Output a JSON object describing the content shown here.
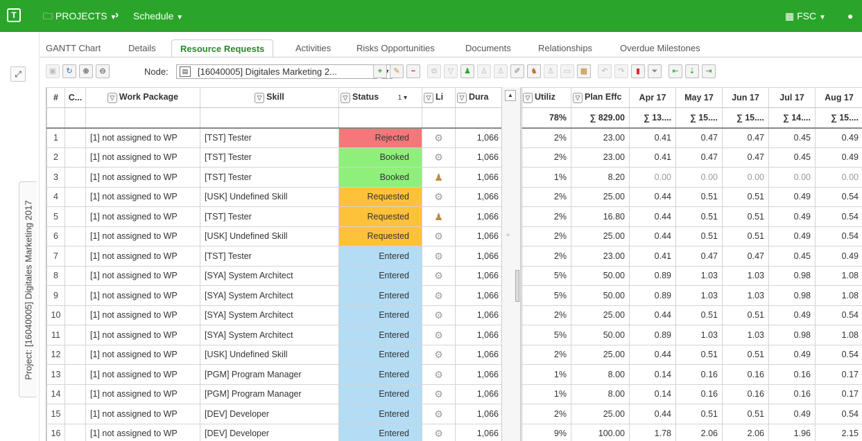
{
  "topbar": {
    "projects_label": "PROJECTS",
    "schedule_label": "Schedule",
    "user_label": "FSC"
  },
  "side": {
    "vertical_tab_label": "Project: [16040005] Digitales Marketing 2017"
  },
  "tabs": [
    {
      "label": "GANTT Chart"
    },
    {
      "label": "Details"
    },
    {
      "label": "Resource Requests"
    },
    {
      "label": "Activities"
    },
    {
      "label": "Risks Opportunities"
    },
    {
      "label": "Documents"
    },
    {
      "label": "Relationships"
    },
    {
      "label": "Overdue Milestones"
    }
  ],
  "toolbar": {
    "node_label": "Node:",
    "node_value": "[16040005] Digitales Marketing 2..."
  },
  "left_headers": {
    "num": "#",
    "c": "C...",
    "work_package": "Work Package",
    "skill": "Skill",
    "status": "Status",
    "sort": "1 ▾",
    "li": "Li",
    "dura": "Dura"
  },
  "right_headers": {
    "utiliz": "Utiliz",
    "plan_effort": "Plan Effc",
    "months": [
      "Apr 17",
      "May 17",
      "Jun 17",
      "Jul 17",
      "Aug 17"
    ]
  },
  "summary": {
    "utiliz": "78%",
    "plan_effort": "∑ 829.00",
    "months": [
      "∑ 13....",
      "∑ 15....",
      "∑ 15....",
      "∑ 14....",
      "∑ 15...."
    ]
  },
  "rows": [
    {
      "n": "1",
      "wp": "[1] not assigned to WP",
      "skill": "[TST] Tester",
      "status": "Rejected",
      "icon": "gear",
      "dur": "1,066",
      "util": "2%",
      "plan": "23.00",
      "m": [
        "0.41",
        "0.47",
        "0.47",
        "0.45",
        "0.49"
      ]
    },
    {
      "n": "2",
      "wp": "[1] not assigned to WP",
      "skill": "[TST] Tester",
      "status": "Booked",
      "icon": "gear",
      "dur": "1,066",
      "util": "2%",
      "plan": "23.00",
      "m": [
        "0.41",
        "0.47",
        "0.47",
        "0.45",
        "0.49"
      ]
    },
    {
      "n": "3",
      "wp": "[1] not assigned to WP",
      "skill": "[TST] Tester",
      "status": "Booked",
      "icon": "person",
      "dur": "1,066",
      "util": "1%",
      "plan": "8.20",
      "m": [
        "0.00",
        "0.00",
        "0.00",
        "0.00",
        "0.00"
      ]
    },
    {
      "n": "4",
      "wp": "[1] not assigned to WP",
      "skill": "[USK] Undefined Skill",
      "status": "Requested",
      "icon": "gear",
      "dur": "1,066",
      "util": "2%",
      "plan": "25.00",
      "m": [
        "0.44",
        "0.51",
        "0.51",
        "0.49",
        "0.54"
      ]
    },
    {
      "n": "5",
      "wp": "[1] not assigned to WP",
      "skill": "[TST] Tester",
      "status": "Requested",
      "icon": "person",
      "dur": "1,066",
      "util": "2%",
      "plan": "16.80",
      "m": [
        "0.44",
        "0.51",
        "0.51",
        "0.49",
        "0.54"
      ]
    },
    {
      "n": "6",
      "wp": "[1] not assigned to WP",
      "skill": "[USK] Undefined Skill",
      "status": "Requested",
      "icon": "gear",
      "dur": "1,066",
      "util": "2%",
      "plan": "25.00",
      "m": [
        "0.44",
        "0.51",
        "0.51",
        "0.49",
        "0.54"
      ]
    },
    {
      "n": "7",
      "wp": "[1] not assigned to WP",
      "skill": "[TST] Tester",
      "status": "Entered",
      "icon": "gear",
      "dur": "1,066",
      "util": "2%",
      "plan": "23.00",
      "m": [
        "0.41",
        "0.47",
        "0.47",
        "0.45",
        "0.49"
      ]
    },
    {
      "n": "8",
      "wp": "[1] not assigned to WP",
      "skill": "[SYA] System Architect",
      "status": "Entered",
      "icon": "gear",
      "dur": "1,066",
      "util": "5%",
      "plan": "50.00",
      "m": [
        "0.89",
        "1.03",
        "1.03",
        "0.98",
        "1.08"
      ]
    },
    {
      "n": "9",
      "wp": "[1] not assigned to WP",
      "skill": "[SYA] System Architect",
      "status": "Entered",
      "icon": "gear",
      "dur": "1,066",
      "util": "5%",
      "plan": "50.00",
      "m": [
        "0.89",
        "1.03",
        "1.03",
        "0.98",
        "1.08"
      ]
    },
    {
      "n": "10",
      "wp": "[1] not assigned to WP",
      "skill": "[SYA] System Architect",
      "status": "Entered",
      "icon": "gear",
      "dur": "1,066",
      "util": "2%",
      "plan": "25.00",
      "m": [
        "0.44",
        "0.51",
        "0.51",
        "0.49",
        "0.54"
      ]
    },
    {
      "n": "11",
      "wp": "[1] not assigned to WP",
      "skill": "[SYA] System Architect",
      "status": "Entered",
      "icon": "gear",
      "dur": "1,066",
      "util": "5%",
      "plan": "50.00",
      "m": [
        "0.89",
        "1.03",
        "1.03",
        "0.98",
        "1.08"
      ]
    },
    {
      "n": "12",
      "wp": "[1] not assigned to WP",
      "skill": "[USK] Undefined Skill",
      "status": "Entered",
      "icon": "gear",
      "dur": "1,066",
      "util": "2%",
      "plan": "25.00",
      "m": [
        "0.44",
        "0.51",
        "0.51",
        "0.49",
        "0.54"
      ]
    },
    {
      "n": "13",
      "wp": "[1] not assigned to WP",
      "skill": "[PGM] Program Manager",
      "status": "Entered",
      "icon": "gear",
      "dur": "1,066",
      "util": "1%",
      "plan": "8.00",
      "m": [
        "0.14",
        "0.16",
        "0.16",
        "0.16",
        "0.17"
      ]
    },
    {
      "n": "14",
      "wp": "[1] not assigned to WP",
      "skill": "[PGM] Program Manager",
      "status": "Entered",
      "icon": "gear",
      "dur": "1,066",
      "util": "1%",
      "plan": "8.00",
      "m": [
        "0.14",
        "0.16",
        "0.16",
        "0.16",
        "0.17"
      ]
    },
    {
      "n": "15",
      "wp": "[1] not assigned to WP",
      "skill": "[DEV] Developer",
      "status": "Entered",
      "icon": "gear",
      "dur": "1,066",
      "util": "2%",
      "plan": "25.00",
      "m": [
        "0.44",
        "0.51",
        "0.51",
        "0.49",
        "0.54"
      ]
    },
    {
      "n": "16",
      "wp": "[1] not assigned to WP",
      "skill": "[DEV] Developer",
      "status": "Entered",
      "icon": "gear",
      "dur": "1,066",
      "util": "9%",
      "plan": "100.00",
      "m": [
        "1.78",
        "2.06",
        "2.06",
        "1.96",
        "2.15"
      ]
    }
  ],
  "colors": {
    "topbar": "#2aa52a",
    "rejected": "#f4787a",
    "booked": "#8ef07a",
    "requested": "#fdc23a",
    "entered": "#b3dcf5",
    "active_tab": "#2a8a2a"
  }
}
